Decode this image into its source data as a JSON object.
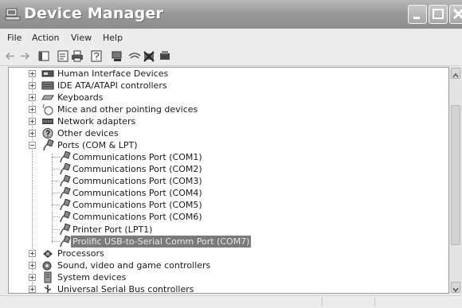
{
  "window": {
    "title": "Device Manager"
  },
  "menu": [
    "File",
    "Action",
    "View",
    "Help"
  ],
  "toolbar": {
    "icons": [
      "back-arrow-icon",
      "forward-arrow-icon",
      "show-hide-tree-icon",
      "properties-icon",
      "print-icon",
      "help-icon",
      "scan-hardware-icon",
      "update-driver-icon",
      "uninstall-icon",
      "disable-icon"
    ]
  },
  "tree": {
    "categories_above": [
      {
        "label": "Human Interface Devices",
        "icon": "human-interface-device-icon"
      },
      {
        "label": "IDE ATA/ATAPI controllers",
        "icon": "ide-controller-icon"
      },
      {
        "label": "Keyboards",
        "icon": "keyboard-icon"
      },
      {
        "label": "Mice and other pointing devices",
        "icon": "mouse-icon"
      },
      {
        "label": "Network adapters",
        "icon": "network-adapter-icon"
      },
      {
        "label": "Other devices",
        "icon": "unknown-device-icon"
      }
    ],
    "ports": {
      "label": "Ports (COM & LPT)",
      "icon": "port-connector-icon"
    },
    "port_children": [
      {
        "label": "Communications Port (COM1)"
      },
      {
        "label": "Communications Port (COM2)"
      },
      {
        "label": "Communications Port (COM3)"
      },
      {
        "label": "Communications Port (COM4)"
      },
      {
        "label": "Communications Port (COM5)"
      },
      {
        "label": "Communications Port (COM6)"
      },
      {
        "label": "Printer Port (LPT1)"
      },
      {
        "label": "Prolific USB-to-Serial Comm Port (COM7)",
        "selected": true
      }
    ],
    "categories_below": [
      {
        "label": "Processors",
        "icon": "processor-icon"
      },
      {
        "label": "Sound, video and game controllers",
        "icon": "sound-icon"
      },
      {
        "label": "System devices",
        "icon": "system-device-icon"
      },
      {
        "label": "Universal Serial Bus controllers",
        "icon": "usb-controller-icon"
      }
    ]
  },
  "colors": {
    "title_bar": "#9a9a9a",
    "selection": "#7a7a7a",
    "tree_background": "#ffffff"
  }
}
